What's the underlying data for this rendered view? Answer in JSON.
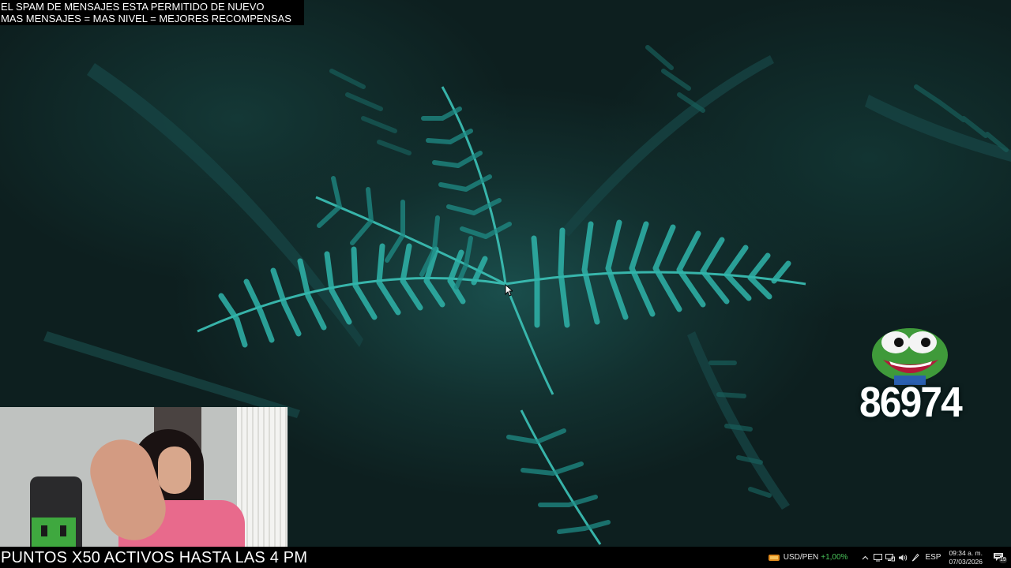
{
  "announcement": {
    "line1": "EL SPAM DE MENSAJES ESTA PERMITIDO DE NUEVO",
    "line2": "MAS MENSAJES = MAS NIVEL = MEJORES RECOMPENSAS"
  },
  "counter": {
    "value": "86974",
    "icon": "pepe-frog-icon"
  },
  "ticker": {
    "text": "PUNTOS X50 ACTIVOS HASTA LAS 4 PM"
  },
  "taskbar": {
    "currency_pair": "USD/PEN",
    "currency_change": "+1,00%",
    "language": "ESP",
    "time": "09:34 a. m.",
    "date": "07/03/2026",
    "notification_count": "19",
    "icons": [
      "chevron-up-icon",
      "display-icon",
      "network-icon",
      "volume-icon",
      "pen-icon"
    ]
  },
  "colors": {
    "wallpaper": "#0d1f1f",
    "fern": "#2aa7a0",
    "fx_positive": "#49c35a"
  }
}
